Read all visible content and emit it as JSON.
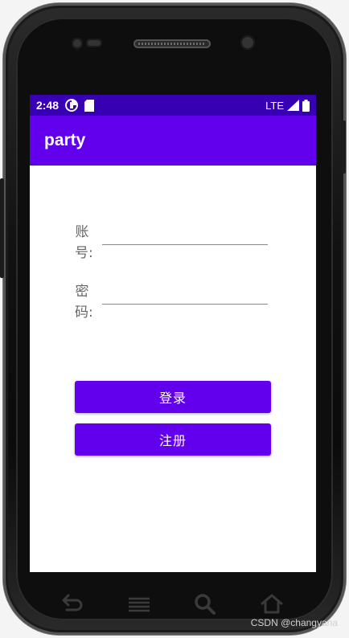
{
  "status_bar": {
    "time": "2:48",
    "network": "LTE",
    "icons": [
      "data-saver-icon",
      "sd-card-icon",
      "signal-icon",
      "battery-icon"
    ]
  },
  "app_bar": {
    "title": "party"
  },
  "form": {
    "account_label": "账号:",
    "password_label": "密码:",
    "account_value": "",
    "password_value": ""
  },
  "buttons": {
    "login": "登录",
    "register": "注册"
  },
  "nav_bar": {
    "icons": [
      "back-icon",
      "menu-icon",
      "search-icon",
      "home-icon"
    ]
  },
  "watermark": "CSDN @changyana",
  "colors": {
    "primary": "#6200EE",
    "primary_dark": "#3700B3",
    "surface": "#FFFFFF"
  }
}
